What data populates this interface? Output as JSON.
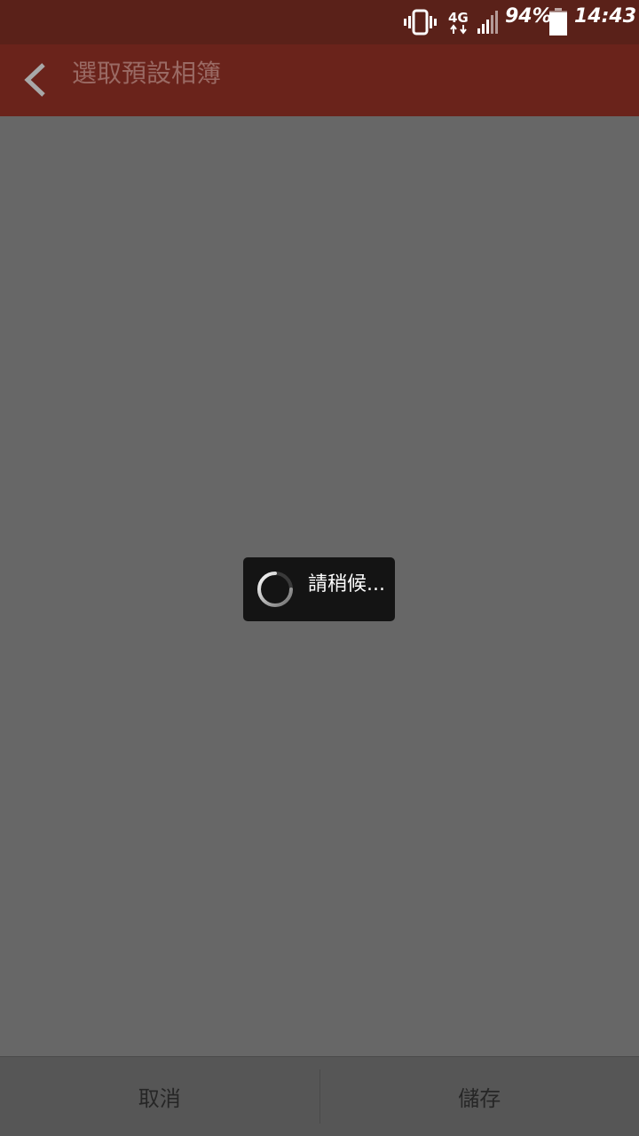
{
  "status_bar": {
    "battery_percent": "94%",
    "battery_level": 0.94,
    "time": "14:43",
    "network_type": "4G",
    "icons": [
      "vibrate-icon",
      "network-4g-icon",
      "signal-icon",
      "battery-icon"
    ]
  },
  "app_bar": {
    "title": "選取預設相簿",
    "back_icon": "chevron-left-icon"
  },
  "dialog": {
    "message": "請稍候..."
  },
  "bottom_bar": {
    "cancel_label": "取消",
    "save_label": "儲存"
  },
  "colors": {
    "status_bar": "#5a2119",
    "app_bar": "#6a231b",
    "title_text": "#9a6a64",
    "content_background": "#676767",
    "dialog_background": "#141414",
    "bottom_bar": "#565656",
    "bottom_text": "#262626"
  }
}
